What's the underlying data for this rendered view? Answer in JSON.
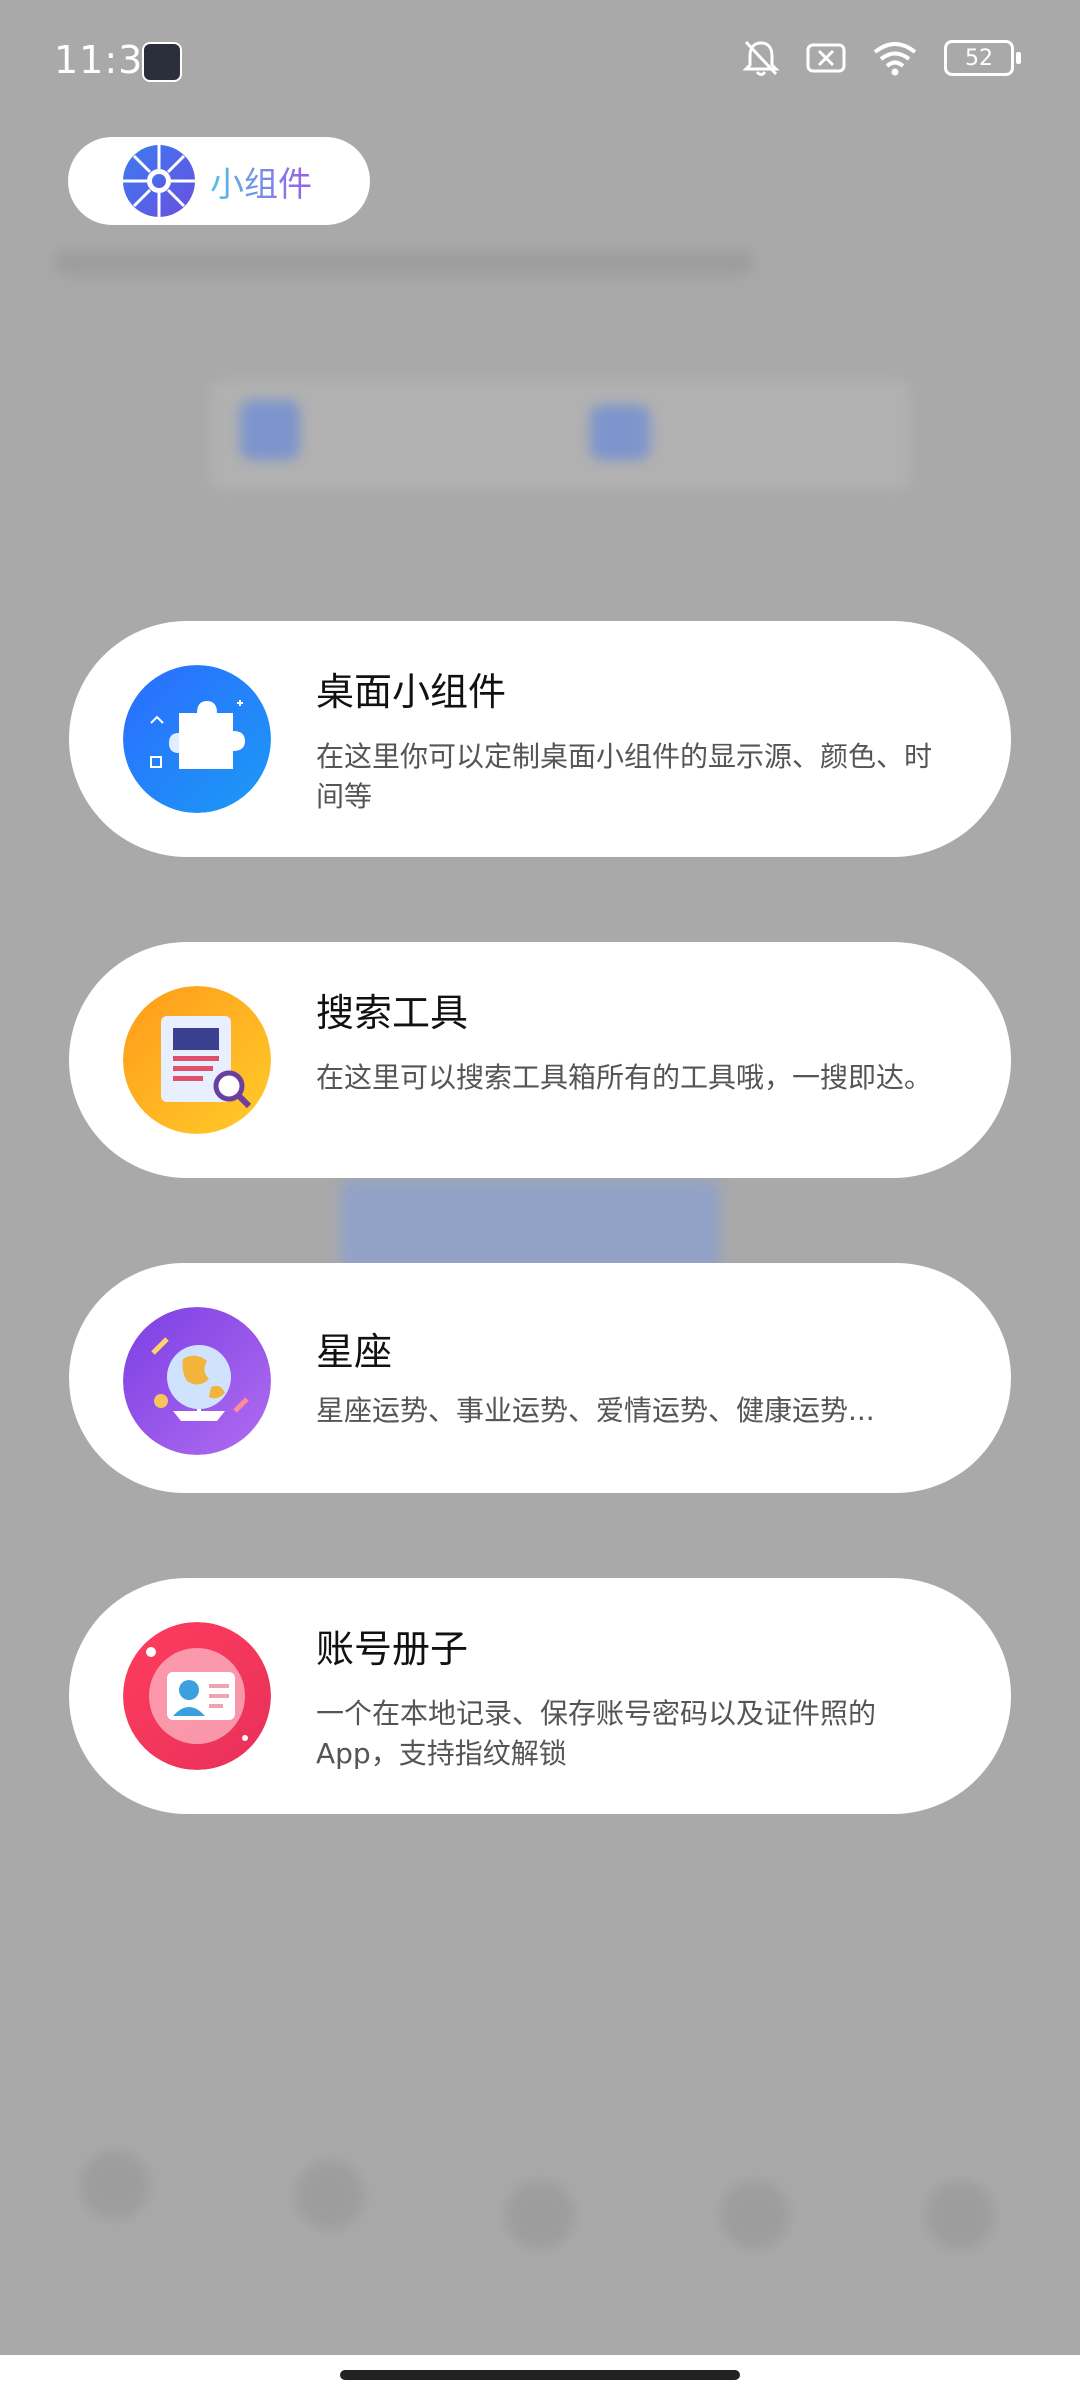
{
  "status_bar": {
    "time": "11:31",
    "battery": "52"
  },
  "header": {
    "title": "小组件"
  },
  "cards": [
    {
      "title": "桌面小组件",
      "desc": "在这里你可以定制桌面小组件的显示源、颜色、时间等",
      "icon": "puzzle-icon"
    },
    {
      "title": "搜索工具",
      "desc": "在这里可以搜索工具箱所有的工具哦，一搜即达。",
      "icon": "document-search-icon"
    },
    {
      "title": "星座",
      "desc": "星座运势、事业运势、爱情运势、健康运势...",
      "icon": "globe-constellation-icon"
    },
    {
      "title": "账号册子",
      "desc": "一个在本地记录、保存账号密码以及证件照的App，支持指纹解锁",
      "icon": "id-card-icon"
    }
  ],
  "colors": {
    "overlay": "#a9a9a9",
    "card_bg": "#ffffff",
    "title": "#111111",
    "desc": "#555555"
  }
}
